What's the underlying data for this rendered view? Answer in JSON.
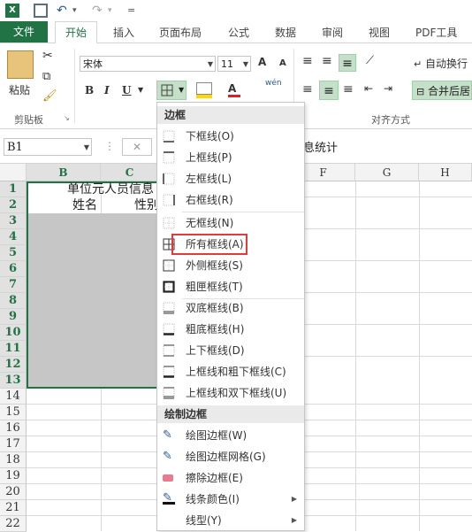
{
  "qat": {
    "excel_logo": "X",
    "separator": "|",
    "undo_arrow": "▾",
    "redo_arrow": "▾",
    "customize_arrow": "="
  },
  "tabs": [
    "文件",
    "开始",
    "插入",
    "页面布局",
    "公式",
    "数据",
    "审阅",
    "视图",
    "PDF工具"
  ],
  "ribbon": {
    "paste_label": "粘贴",
    "clipboard_label": "剪贴板",
    "font_name": "宋体",
    "font_size": "11",
    "bold": "B",
    "italic": "I",
    "underline": "U",
    "font_a": "A",
    "font_grow": "A",
    "font_shrink": "A",
    "phonetic": "wén",
    "wrap_text": "自动换行",
    "merge_center": "合并后居",
    "alignment_label": "对齐方式"
  },
  "formula_bar": {
    "name_box": "B1",
    "formula_text": "息统计",
    "cancel_symbol": "✕",
    "dots": "⋮"
  },
  "columns": [
    "B",
    "C",
    "F",
    "G",
    "H"
  ],
  "rows": [
    "1",
    "2",
    "3",
    "4",
    "5",
    "6",
    "7",
    "8",
    "9",
    "10",
    "11",
    "12",
    "13",
    "14",
    "15",
    "16",
    "17",
    "18",
    "19",
    "20",
    "21",
    "22"
  ],
  "cells": {
    "title": "单位元人员信息",
    "name_header": "姓名",
    "gender_header": "性别"
  },
  "menu": {
    "section_border": "边框",
    "section_draw": "绘制边框",
    "items": [
      "下框线(O)",
      "上框线(P)",
      "左框线(L)",
      "右框线(R)",
      "无框线(N)",
      "所有框线(A)",
      "外侧框线(S)",
      "粗匣框线(T)",
      "双底框线(B)",
      "粗底框线(H)",
      "上下框线(D)",
      "上框线和粗下框线(C)",
      "上框线和双下框线(U)"
    ],
    "draw_items": [
      "绘图边框(W)",
      "绘图边框网格(G)",
      "擦除边框(E)",
      "线条颜色(I)",
      "线型(Y)"
    ]
  },
  "colors": {
    "excel_green": "#217346",
    "highlight": "#e23b3b",
    "selection": "#c6c6c6"
  }
}
